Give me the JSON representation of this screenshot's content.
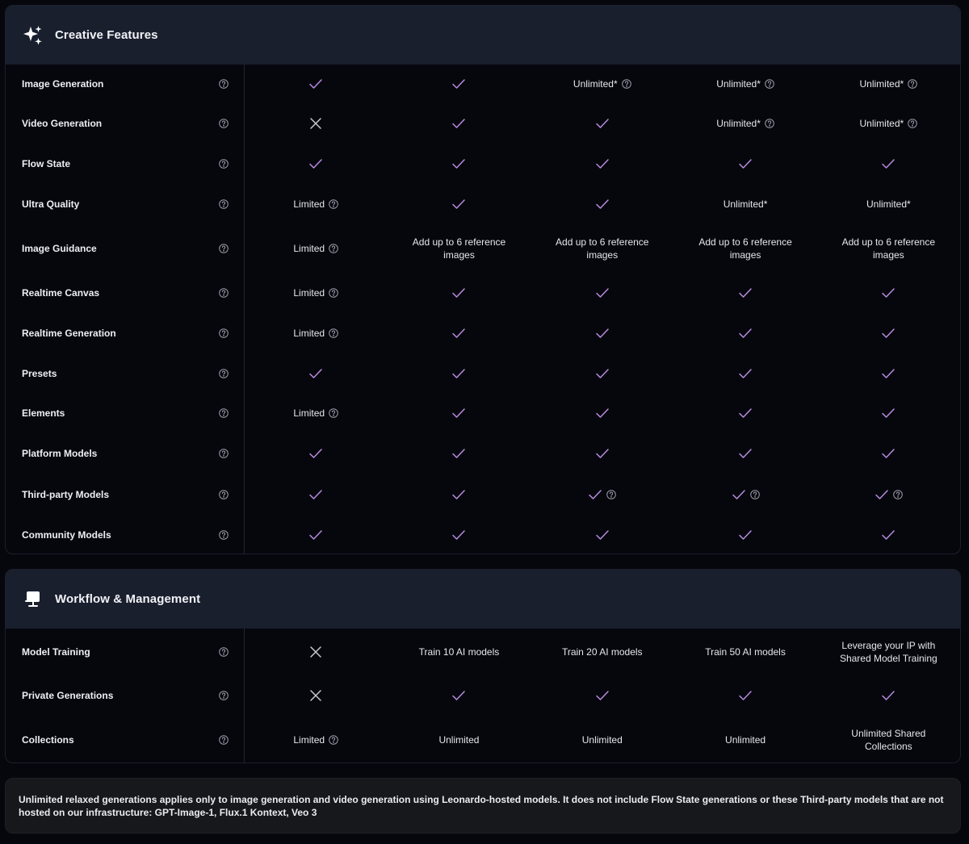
{
  "sections": {
    "creative": {
      "title": "Creative Features",
      "icon": "sparkles-icon",
      "rows": [
        {
          "label": "Image Generation",
          "cells": [
            {
              "t": "check"
            },
            {
              "t": "check"
            },
            {
              "t": "text",
              "v": "Unlimited*",
              "help": true
            },
            {
              "t": "text",
              "v": "Unlimited*",
              "help": true
            },
            {
              "t": "text",
              "v": "Unlimited*",
              "help": true
            }
          ]
        },
        {
          "label": "Video Generation",
          "cells": [
            {
              "t": "cross"
            },
            {
              "t": "check"
            },
            {
              "t": "check"
            },
            {
              "t": "text",
              "v": "Unlimited*",
              "help": true
            },
            {
              "t": "text",
              "v": "Unlimited*",
              "help": true
            }
          ]
        },
        {
          "label": "Flow State",
          "cells": [
            {
              "t": "check"
            },
            {
              "t": "check"
            },
            {
              "t": "check"
            },
            {
              "t": "check"
            },
            {
              "t": "check"
            }
          ]
        },
        {
          "label": "Ultra Quality",
          "cells": [
            {
              "t": "text",
              "v": "Limited",
              "help": true
            },
            {
              "t": "check"
            },
            {
              "t": "check"
            },
            {
              "t": "text",
              "v": "Unlimited*"
            },
            {
              "t": "text",
              "v": "Unlimited*"
            }
          ]
        },
        {
          "label": "Image Guidance",
          "cells": [
            {
              "t": "text",
              "v": "Limited",
              "help": true
            },
            {
              "t": "text",
              "v": "Add up to 6 reference images"
            },
            {
              "t": "text",
              "v": "Add up to 6 reference images"
            },
            {
              "t": "text",
              "v": "Add up to 6 reference images"
            },
            {
              "t": "text",
              "v": "Add up to 6 reference images"
            }
          ]
        },
        {
          "label": "Realtime Canvas",
          "cells": [
            {
              "t": "text",
              "v": "Limited",
              "help": true
            },
            {
              "t": "check"
            },
            {
              "t": "check"
            },
            {
              "t": "check"
            },
            {
              "t": "check"
            }
          ]
        },
        {
          "label": "Realtime Generation",
          "cells": [
            {
              "t": "text",
              "v": "Limited",
              "help": true
            },
            {
              "t": "check"
            },
            {
              "t": "check"
            },
            {
              "t": "check"
            },
            {
              "t": "check"
            }
          ]
        },
        {
          "label": "Presets",
          "cells": [
            {
              "t": "check"
            },
            {
              "t": "check"
            },
            {
              "t": "check"
            },
            {
              "t": "check"
            },
            {
              "t": "check"
            }
          ]
        },
        {
          "label": "Elements",
          "cells": [
            {
              "t": "text",
              "v": "Limited",
              "help": true
            },
            {
              "t": "check"
            },
            {
              "t": "check"
            },
            {
              "t": "check"
            },
            {
              "t": "check"
            }
          ]
        },
        {
          "label": "Platform Models",
          "cells": [
            {
              "t": "check"
            },
            {
              "t": "check"
            },
            {
              "t": "check"
            },
            {
              "t": "check"
            },
            {
              "t": "check"
            }
          ]
        },
        {
          "label": "Third-party Models",
          "cells": [
            {
              "t": "check"
            },
            {
              "t": "check"
            },
            {
              "t": "check",
              "help": true
            },
            {
              "t": "check",
              "help": true
            },
            {
              "t": "check",
              "help": true
            }
          ]
        },
        {
          "label": "Community Models",
          "cells": [
            {
              "t": "check"
            },
            {
              "t": "check"
            },
            {
              "t": "check"
            },
            {
              "t": "check"
            },
            {
              "t": "check"
            }
          ]
        }
      ]
    },
    "workflow": {
      "title": "Workflow & Management",
      "icon": "presentation-icon",
      "rows": [
        {
          "label": "Model Training",
          "cells": [
            {
              "t": "cross"
            },
            {
              "t": "text",
              "v": "Train 10 AI models"
            },
            {
              "t": "text",
              "v": "Train 20 AI models"
            },
            {
              "t": "text",
              "v": "Train 50 AI models"
            },
            {
              "t": "text",
              "v": "Leverage your IP with Shared Model Training"
            }
          ]
        },
        {
          "label": "Private Generations",
          "cells": [
            {
              "t": "cross"
            },
            {
              "t": "check"
            },
            {
              "t": "check"
            },
            {
              "t": "check"
            },
            {
              "t": "check"
            }
          ]
        },
        {
          "label": "Collections",
          "cells": [
            {
              "t": "text",
              "v": "Limited",
              "help": true
            },
            {
              "t": "text",
              "v": "Unlimited"
            },
            {
              "t": "text",
              "v": "Unlimited"
            },
            {
              "t": "text",
              "v": "Unlimited"
            },
            {
              "t": "text",
              "v": "Unlimited Shared Collections"
            }
          ]
        }
      ]
    }
  },
  "footer_note": "Unlimited relaxed generations applies only to image generation and video generation using Leonardo-hosted models. It does not include Flow State generations or these Third-party models that are not hosted on our infrastructure: GPT-Image-1, Flux.1 Kontext, Veo 3",
  "colors": {
    "check": "#b98be0",
    "cross": "#c9c9d1",
    "header_bg": "#1a1f2e"
  }
}
